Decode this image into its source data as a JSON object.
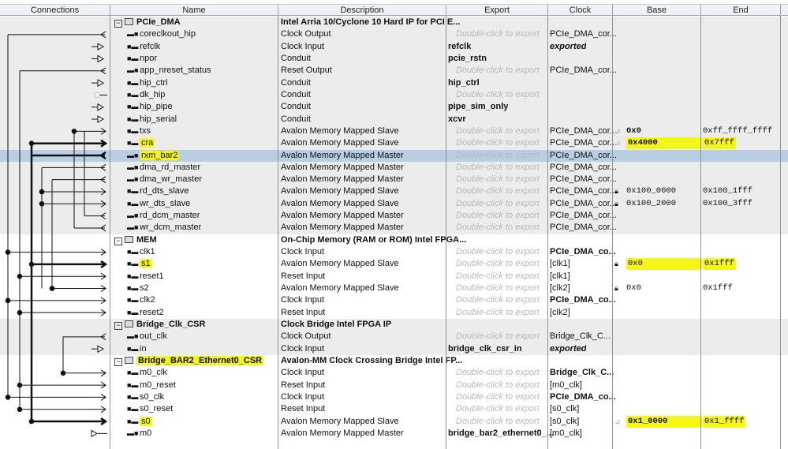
{
  "columns": [
    "Connections",
    "Name",
    "Description",
    "Export",
    "Clock",
    "Base",
    "End"
  ],
  "export_placeholder": "Double-click to export",
  "colors": {
    "highlight": "#f5f51a",
    "selected_row": "#b9cde3",
    "group_gray": "#ececec"
  },
  "rows": [
    {
      "kind": "group",
      "name": "PCIe_DMA",
      "desc": "Intel Arria 10/Cyclone 10 Hard IP for PCI E...",
      "gray": true
    },
    {
      "name": "coreclkout_hip",
      "dir": "out",
      "desc": "Clock Output",
      "clock": "PCIe_DMA_cor..."
    },
    {
      "name": "refclk",
      "dir": "in",
      "desc": "Clock Input",
      "export": "refclk",
      "clock": "exported",
      "clock_style": "it"
    },
    {
      "name": "npor",
      "dir": "in",
      "desc": "Conduit",
      "export": "pcie_rstn"
    },
    {
      "name": "app_nreset_status",
      "dir": "out",
      "desc": "Reset Output",
      "clock": "PCIe_DMA_cor..."
    },
    {
      "name": "hip_ctrl",
      "dir": "in",
      "desc": "Conduit",
      "export": "hip_ctrl"
    },
    {
      "name": "dk_hip",
      "dir": "in",
      "desc": "Conduit"
    },
    {
      "name": "hip_pipe",
      "dir": "in",
      "desc": "Conduit",
      "export": "pipe_sim_only"
    },
    {
      "name": "hip_serial",
      "dir": "in",
      "desc": "Conduit",
      "export": "xcvr"
    },
    {
      "name": "txs",
      "dir": "in",
      "desc": "Avalon Memory Mapped Slave",
      "clock": "PCIe_DMA_cor...",
      "lock": "open",
      "base": "0x0",
      "end": "0xff_ffff_ffff",
      "base_bold": true
    },
    {
      "name": "cra",
      "dir": "in",
      "desc": "Avalon Memory Mapped Slave",
      "clock": "PCIe_DMA_cor...",
      "lock": "open",
      "base": "0x4000",
      "end": "0x7fff",
      "highlight": true,
      "addr_highlight": true,
      "base_bold": true
    },
    {
      "name": "rxm_bar2",
      "dir": "out",
      "desc": "Avalon Memory Mapped Master",
      "clock": "PCIe_DMA_cor...",
      "highlight": true,
      "selected": true
    },
    {
      "name": "dma_rd_master",
      "dir": "out",
      "desc": "Avalon Memory Mapped Master",
      "clock": "PCIe_DMA_cor..."
    },
    {
      "name": "dma_wr_master",
      "dir": "out",
      "desc": "Avalon Memory Mapped Master",
      "clock": "PCIe_DMA_cor..."
    },
    {
      "name": "rd_dts_slave",
      "dir": "in",
      "desc": "Avalon Memory Mapped Slave",
      "clock": "PCIe_DMA_cor...",
      "lock": "closed",
      "base": "0x100_0000",
      "end": "0x100_1fff"
    },
    {
      "name": "wr_dts_slave",
      "dir": "in",
      "desc": "Avalon Memory Mapped Slave",
      "clock": "PCIe_DMA_cor...",
      "lock": "closed",
      "base": "0x100_2000",
      "end": "0x100_3fff"
    },
    {
      "name": "rd_dcm_master",
      "dir": "out",
      "desc": "Avalon Memory Mapped Master",
      "clock": "PCIe_DMA_cor..."
    },
    {
      "name": "wr_dcm_master",
      "dir": "out",
      "desc": "Avalon Memory Mapped Master",
      "clock": "PCIe_DMA_cor..."
    },
    {
      "kind": "group",
      "name": "MEM",
      "desc": "On-Chip Memory (RAM or ROM) Intel FPGA..."
    },
    {
      "name": "clk1",
      "dir": "in",
      "desc": "Clock Input",
      "clock": "PCIe_DMA_co...",
      "clock_style": "b"
    },
    {
      "name": "s1",
      "dir": "in",
      "desc": "Avalon Memory Mapped Slave",
      "clock": "[clk1]",
      "lock": "closed",
      "base": "0x0",
      "end": "0x1fff",
      "highlight": true,
      "addr_highlight": true
    },
    {
      "name": "reset1",
      "dir": "in",
      "desc": "Reset Input",
      "clock": "[clk1]"
    },
    {
      "name": "s2",
      "dir": "in",
      "desc": "Avalon Memory Mapped Slave",
      "clock": "[clk2]",
      "lock": "closed",
      "base": "0x0",
      "end": "0x1fff"
    },
    {
      "name": "clk2",
      "dir": "in",
      "desc": "Clock Input",
      "clock": "PCIe_DMA_co...",
      "clock_style": "b"
    },
    {
      "name": "reset2",
      "dir": "in",
      "desc": "Reset Input",
      "clock": "[clk2]"
    },
    {
      "kind": "group",
      "name": "Bridge_Clk_CSR",
      "desc": "Clock Bridge Intel FPGA IP",
      "gray": true
    },
    {
      "name": "out_clk",
      "dir": "out",
      "desc": "Clock Output",
      "clock": "Bridge_Clk_C..."
    },
    {
      "name": "in",
      "dir": "in",
      "desc": "Clock Input",
      "export": "bridge_clk_csr_in",
      "clock": "exported",
      "clock_style": "it"
    },
    {
      "kind": "group",
      "name": "Bridge_BAR2_Ethernet0_CSR",
      "desc": "Avalon-MM Clock Crossing Bridge Intel FP...",
      "highlight": true
    },
    {
      "name": "m0_clk",
      "dir": "in",
      "desc": "Clock Input",
      "clock": "Bridge_Clk_C...",
      "clock_style": "b"
    },
    {
      "name": "m0_reset",
      "dir": "in",
      "desc": "Reset Input",
      "clock": "[m0_clk]"
    },
    {
      "name": "s0_clk",
      "dir": "in",
      "desc": "Clock Input",
      "clock": "PCIe_DMA_co...",
      "clock_style": "b"
    },
    {
      "name": "s0_reset",
      "dir": "in",
      "desc": "Reset Input",
      "clock": "[s0_clk]"
    },
    {
      "name": "s0",
      "dir": "in",
      "desc": "Avalon Memory Mapped Slave",
      "clock": "[s0_clk]",
      "lock": "open",
      "base": "0x1_0000",
      "end": "0x1_ffff",
      "highlight": true,
      "addr_highlight": true,
      "base_bold": true
    },
    {
      "name": "m0",
      "dir": "out",
      "desc": "Avalon Memory Mapped Master",
      "export": "bridge_bar2_ethernet0_...",
      "clock": "[m0_clk]"
    }
  ]
}
